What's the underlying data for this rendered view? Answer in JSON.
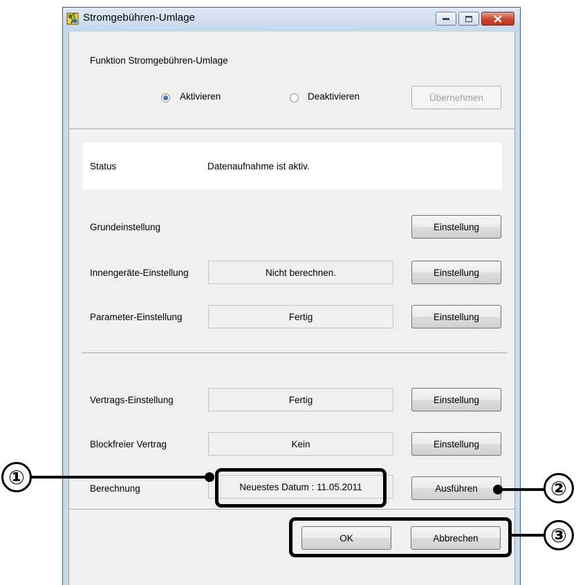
{
  "window": {
    "title": "Stromgebühren-Umlage",
    "controls": [
      "minimize",
      "maximize",
      "close"
    ]
  },
  "function_section": {
    "heading": "Funktion Stromgebühren-Umlage",
    "radio_activate": "Aktivieren",
    "radio_deactivate": "Deaktivieren",
    "selected": "Aktivieren",
    "apply_button": "Übernehmen"
  },
  "status": {
    "label": "Status",
    "value": "Datenaufnahme ist aktiv."
  },
  "settings": [
    {
      "label": "Grundeinstellung",
      "value": null,
      "button": "Einstellung"
    },
    {
      "label": "Innengeräte-Einstellung",
      "value": "Nicht berechnen.",
      "button": "Einstellung"
    },
    {
      "label": "Parameter-Einstellung",
      "value": "Fertig",
      "button": "Einstellung"
    }
  ],
  "contract": [
    {
      "label": "Vertrags-Einstellung",
      "value": "Fertig",
      "button": "Einstellung"
    },
    {
      "label": "Blockfreier Vertrag",
      "value": "Kein",
      "button": "Einstellung"
    },
    {
      "label": "Berechnung",
      "value": "Neuestes Datum : 11.05.2011",
      "button": "Ausführen"
    }
  ],
  "footer": {
    "ok": "OK",
    "cancel": "Abbrechen"
  },
  "callouts": [
    "①",
    "②",
    "③"
  ],
  "colors": {
    "frame": "#c9d9ea",
    "close_button": "#c8452d",
    "radio_selected": "#1b4f97"
  }
}
